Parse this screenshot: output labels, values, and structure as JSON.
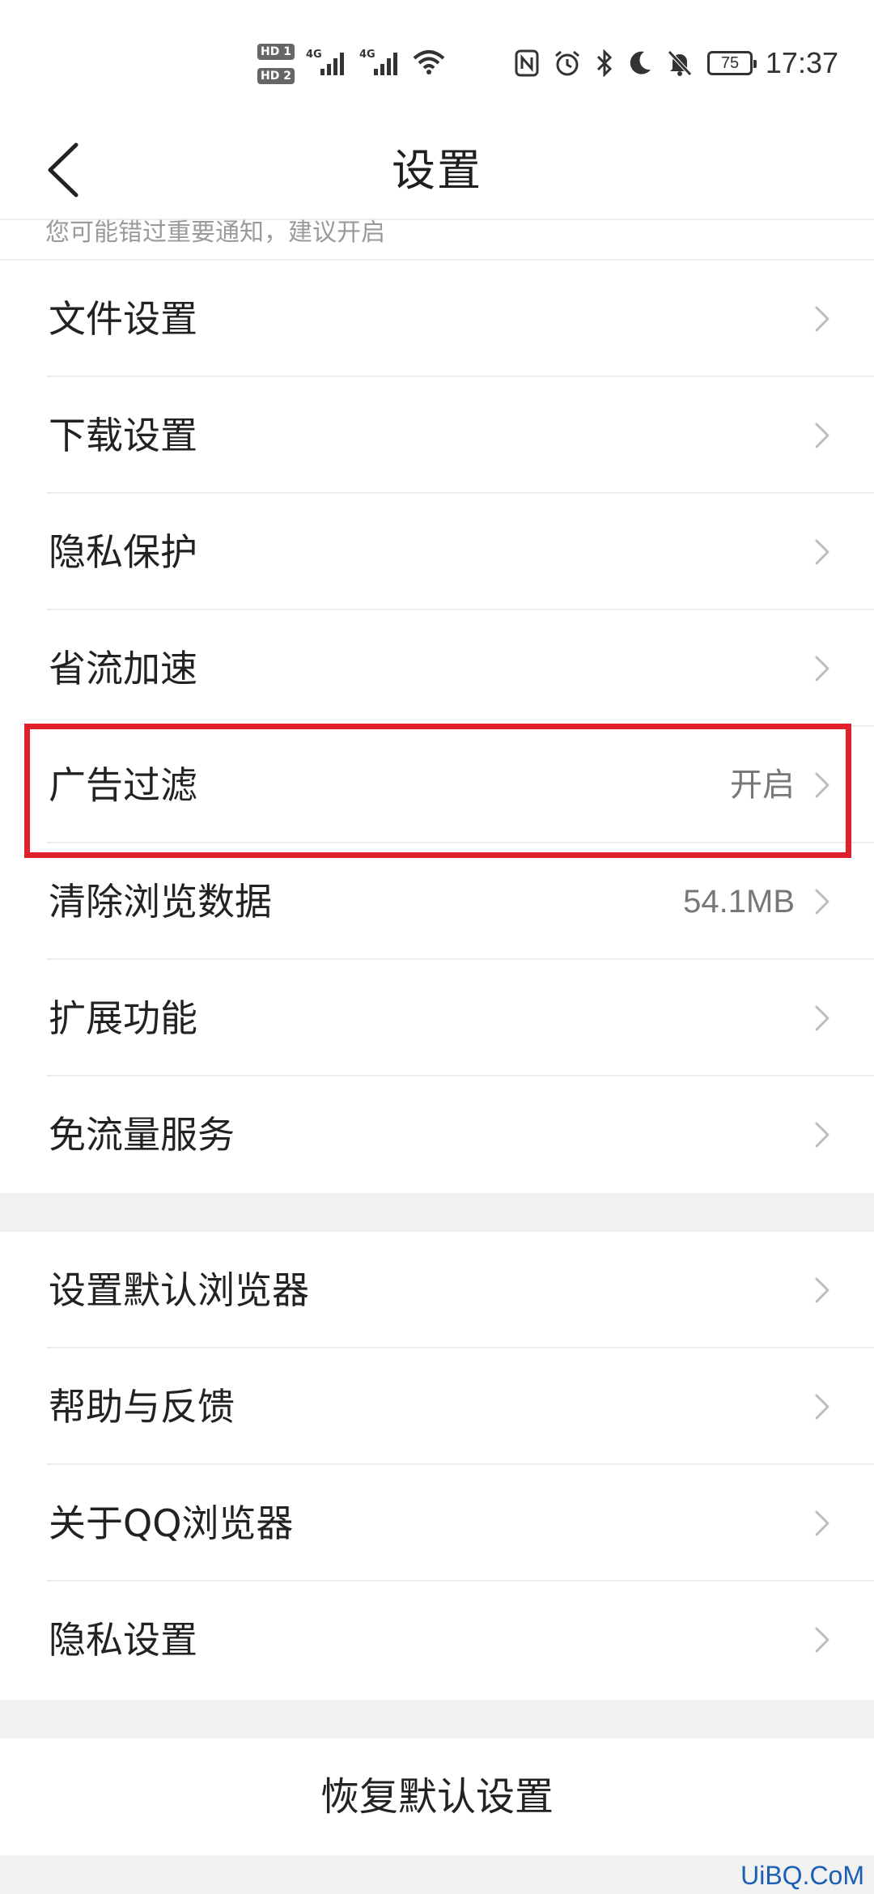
{
  "status_bar": {
    "hd1": "HD 1",
    "hd2": "HD 2",
    "net1": "4G",
    "net2": "4G",
    "battery": "75",
    "time": "17:37",
    "icons": [
      "nfc-icon",
      "alarm-icon",
      "bluetooth-icon",
      "moon-icon",
      "bell-off-icon"
    ]
  },
  "header": {
    "title": "设置",
    "back_icon": "chevron-left-icon"
  },
  "hint": {
    "text": "您可能错过重要通知，建议开启"
  },
  "group1": {
    "items": [
      {
        "label": "文件设置",
        "value": ""
      },
      {
        "label": "下载设置",
        "value": ""
      },
      {
        "label": "隐私保护",
        "value": ""
      },
      {
        "label": "省流加速",
        "value": ""
      },
      {
        "label": "广告过滤",
        "value": "开启"
      },
      {
        "label": "清除浏览数据",
        "value": "54.1MB"
      },
      {
        "label": "扩展功能",
        "value": ""
      },
      {
        "label": "免流量服务",
        "value": ""
      }
    ]
  },
  "group2": {
    "items": [
      {
        "label": "设置默认浏览器",
        "value": ""
      },
      {
        "label": "帮助与反馈",
        "value": ""
      },
      {
        "label": "关于QQ浏览器",
        "value": ""
      },
      {
        "label": "隐私设置",
        "value": ""
      }
    ]
  },
  "restore": {
    "label": "恢复默认设置"
  },
  "watermark": "UiBQ.CoM",
  "colors": {
    "highlight": "#e0202a",
    "divider": "#ececec",
    "section_gap": "#f1f1f1"
  }
}
